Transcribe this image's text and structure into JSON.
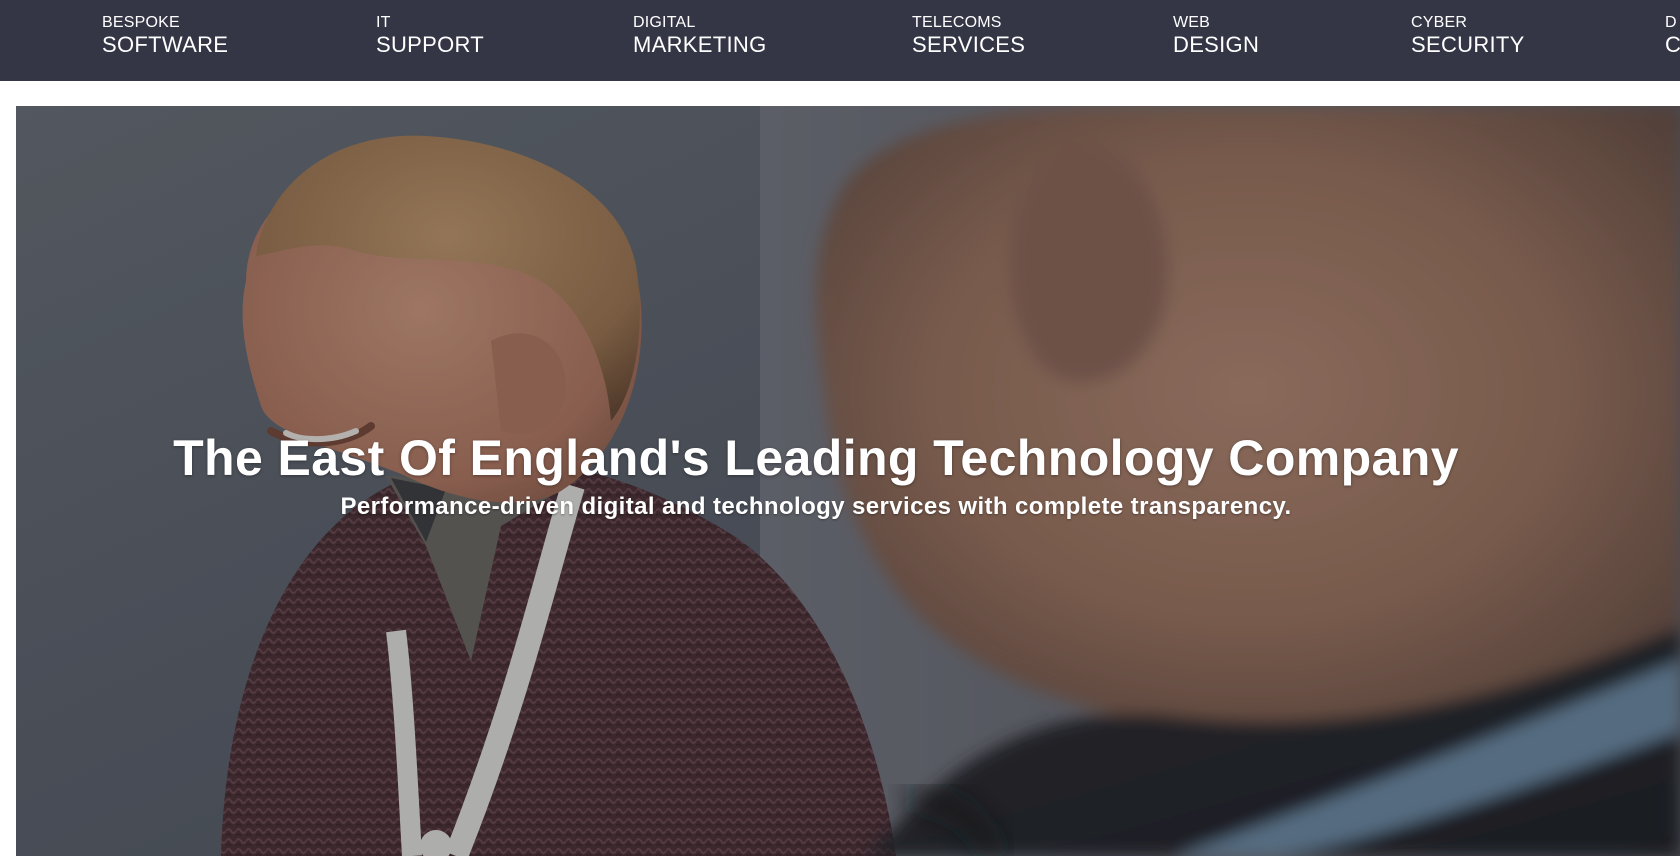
{
  "navigation": {
    "items": [
      {
        "top": "BESPOKE",
        "bottom": "SOFTWARE"
      },
      {
        "top": "IT",
        "bottom": "SUPPORT"
      },
      {
        "top": "DIGITAL",
        "bottom": "MARKETING"
      },
      {
        "top": "TELECOMS",
        "bottom": "SERVICES"
      },
      {
        "top": "WEB",
        "bottom": "DESIGN"
      },
      {
        "top": "CYBER",
        "bottom": "SECURITY"
      },
      {
        "top": "D",
        "bottom": "C"
      }
    ]
  },
  "hero": {
    "title": "The East Of England's Leading Technology Company",
    "subtitle": "Performance-driven digital and technology services with complete transparency."
  },
  "colors": {
    "nav_background": "#343646",
    "text": "#ffffff",
    "page_background": "#ffffff"
  }
}
